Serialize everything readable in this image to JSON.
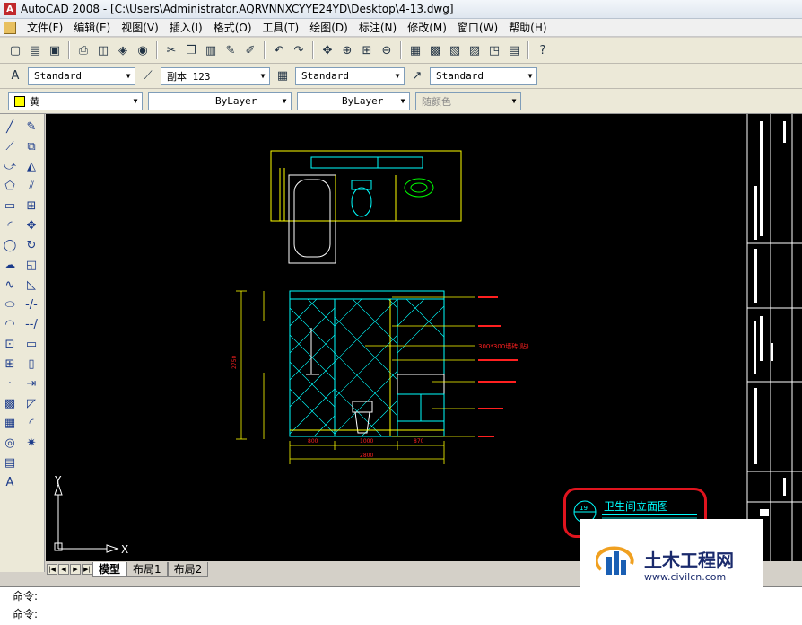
{
  "window": {
    "title": "AutoCAD 2008 - [C:\\Users\\Administrator.AQRVNNXCYYE24YD\\Desktop\\4-13.dwg]"
  },
  "menu": [
    "文件(F)",
    "编辑(E)",
    "视图(V)",
    "插入(I)",
    "格式(O)",
    "工具(T)",
    "绘图(D)",
    "标注(N)",
    "修改(M)",
    "窗口(W)",
    "帮助(H)"
  ],
  "styles": {
    "text_style": "Standard",
    "dim_style": "副本 123",
    "table_style": "Standard",
    "multileader_style": "Standard"
  },
  "properties": {
    "layer": "黄",
    "linetype": "ByLayer",
    "lineweight": "ByLayer",
    "plotstyle": "随颜色"
  },
  "drawing": {
    "title": "卫生间立面图",
    "callout": "19",
    "dims": {
      "total_height": "2750",
      "bottom_1": "800",
      "bottom_2": "1000",
      "bottom_3": "870",
      "total_width": "2800"
    },
    "annotation": "300*300墙砖(贴)",
    "ucs": {
      "x": "X",
      "y": "Y"
    }
  },
  "layout_tabs": [
    "模型",
    "布局1",
    "布局2"
  ],
  "command": {
    "line1": "命令:",
    "line2": "命令:"
  },
  "watermark": {
    "title": "土木工程网",
    "url": "www.civilcn.com"
  },
  "colors": {
    "cad_background": "#000000",
    "highlight": "#e0141e",
    "annotation": "#ff2020",
    "cyan": "#00ffff",
    "yellow": "#ffff00",
    "white": "#ffffff"
  }
}
